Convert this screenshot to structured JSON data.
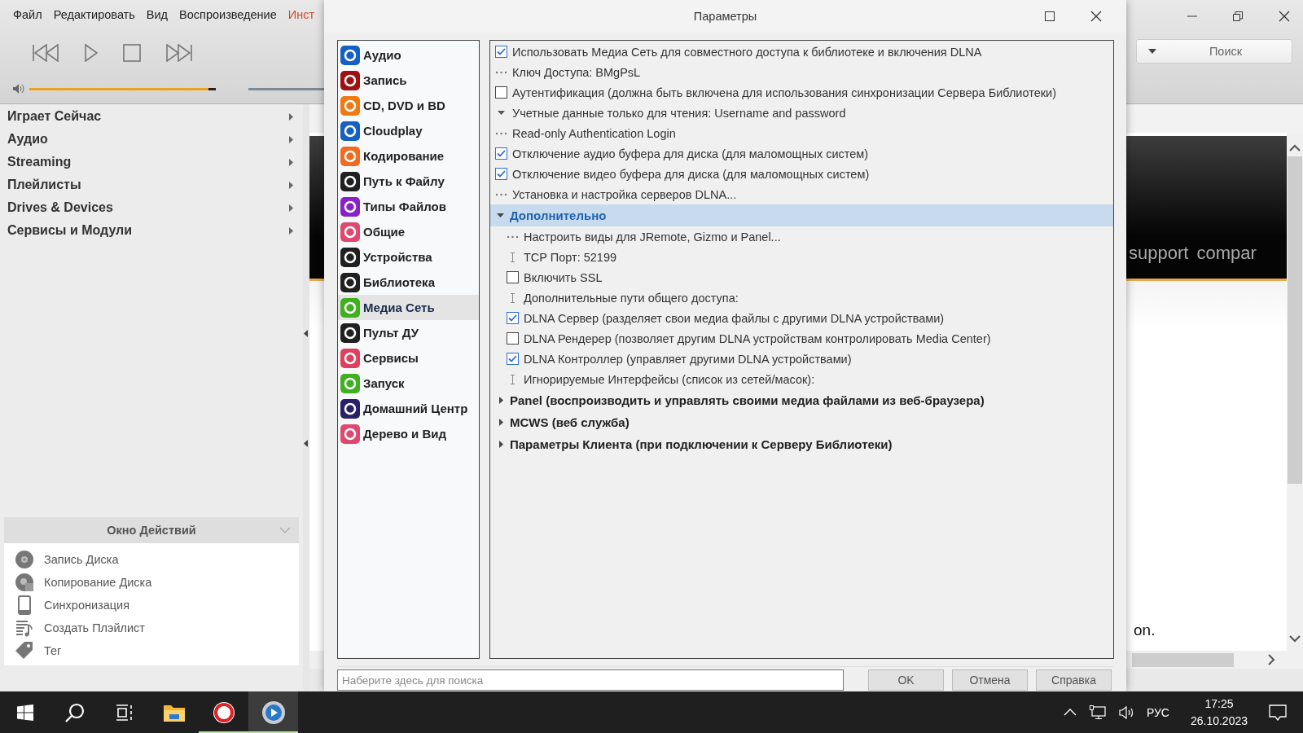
{
  "app": {
    "menu": [
      "Файл",
      "Редактировать",
      "Вид",
      "Воспроизведение",
      "Инст"
    ],
    "volume": {
      "level": 0.96
    },
    "tree": [
      "Играет Сейчас",
      "Аудио",
      "Streaming",
      "Плейлисты",
      "Drives & Devices",
      "Сервисы и Модули"
    ],
    "actions": {
      "title": "Окно Действий",
      "items": [
        {
          "kind": "disc",
          "label": "Запись Диска"
        },
        {
          "kind": "disc-copy",
          "label": "Копирование Диска"
        },
        {
          "kind": "phone",
          "label": "Синхронизация"
        },
        {
          "kind": "playlist",
          "label": "Создать Плэйлист"
        },
        {
          "kind": "tag",
          "label": "Тег"
        }
      ]
    },
    "search": {
      "placeholder": "Поиск"
    },
    "web": {
      "links": [
        "support",
        "compar"
      ],
      "text": "on."
    }
  },
  "dialog": {
    "title": "Параметры",
    "nav": [
      {
        "label": "Аудио",
        "color": "#1560c0",
        "selected": false
      },
      {
        "label": "Запись",
        "color": "#a01010",
        "selected": false
      },
      {
        "label": "CD, DVD и BD",
        "color": "#f07a10",
        "selected": false
      },
      {
        "label": "Cloudplay",
        "color": "#1560c0",
        "selected": false
      },
      {
        "label": "Кодирование",
        "color": "#f06a20",
        "selected": false
      },
      {
        "label": "Путь к Файлу",
        "color": "#202020",
        "selected": false
      },
      {
        "label": "Типы Файлов",
        "color": "#8a20c8",
        "selected": false
      },
      {
        "label": "Общие",
        "color": "#e04870",
        "selected": false
      },
      {
        "label": "Устройства",
        "color": "#202020",
        "selected": false
      },
      {
        "label": "Библиотека",
        "color": "#202020",
        "selected": false
      },
      {
        "label": "Медиа Сеть",
        "color": "#40b020",
        "selected": true
      },
      {
        "label": "Пульт ДУ",
        "color": "#202020",
        "selected": false
      },
      {
        "label": "Сервисы",
        "color": "#e04060",
        "selected": false
      },
      {
        "label": "Запуск",
        "color": "#40b020",
        "selected": false
      },
      {
        "label": "Домашний Центр",
        "color": "#28206a",
        "selected": false
      },
      {
        "label": "Дерево и Вид",
        "color": "#e04870",
        "selected": false
      }
    ],
    "options": [
      {
        "kind": "checkbox",
        "label": "Использовать Медиа Сеть для совместного доступа к библиотеке и включения DLNA",
        "checked": true
      },
      {
        "kind": "action",
        "label": "Ключ Доступа: BMgPsL"
      },
      {
        "kind": "checkbox",
        "label": "Аутентификация (должна быть включена для использования синхронизации Сервера Библиотеки)",
        "checked": false
      },
      {
        "kind": "group",
        "label": "Учетные данные только для чтения: Username and password",
        "expanded": true
      },
      {
        "kind": "action",
        "label": "Read-only Authentication Login"
      },
      {
        "kind": "checkbox",
        "label": "Отключение аудио буфера для диска (для маломощных систем)",
        "checked": true
      },
      {
        "kind": "checkbox",
        "label": "Отключение видео буфера для диска (для маломощных систем)",
        "checked": true
      },
      {
        "kind": "action",
        "label": "Установка и настройка серверов DLNA..."
      },
      {
        "kind": "section",
        "label": "Дополнительно",
        "expanded": true,
        "selected": true,
        "children": [
          {
            "kind": "action",
            "label": "Настроить виды для JRemote, Gizmo и Panel..."
          },
          {
            "kind": "field",
            "label": "TCP Порт: 52199"
          },
          {
            "kind": "checkbox",
            "label": "Включить SSL",
            "checked": false
          },
          {
            "kind": "field",
            "label": "Дополнительные пути общего доступа:"
          },
          {
            "kind": "checkbox",
            "label": "DLNA Сервер (разделяет свои медиа файлы с другими DLNA устройствами)",
            "checked": true
          },
          {
            "kind": "checkbox",
            "label": "DLNA Рендерер (позволяет другим DLNA устройствам контролировать Media Center)",
            "checked": false
          },
          {
            "kind": "checkbox",
            "label": "DLNA Контроллер (управляет другими DLNA устройствами)",
            "checked": true
          },
          {
            "kind": "field",
            "label": "Игнорируемые Интерфейсы (список из сетей/масок):"
          }
        ]
      },
      {
        "kind": "section",
        "label": "Panel (воспроизводить и управлять своими медиа файлами из веб-браузера)",
        "expanded": false,
        "selected": false
      },
      {
        "kind": "section",
        "label": "MCWS (веб служба)",
        "expanded": false,
        "selected": false
      },
      {
        "kind": "section",
        "label": "Параметры Клиента (при подключении к Серверу Библиотеки)",
        "expanded": false,
        "selected": false
      }
    ],
    "search": {
      "placeholder": "Наберите здесь для поиска"
    },
    "buttons": [
      "OK",
      "Отмена",
      "Справка"
    ]
  },
  "taskbar": {
    "apps": [
      {
        "kind": "start",
        "running": false,
        "active": false
      },
      {
        "kind": "search",
        "running": false,
        "active": false
      },
      {
        "kind": "taskview",
        "running": false,
        "active": false
      },
      {
        "kind": "folder",
        "running": false,
        "active": false
      },
      {
        "kind": "browser",
        "running": true,
        "active": false
      },
      {
        "kind": "player",
        "running": true,
        "active": true
      }
    ],
    "language": "РУС",
    "time": "17:25",
    "date": "26.10.2023"
  }
}
